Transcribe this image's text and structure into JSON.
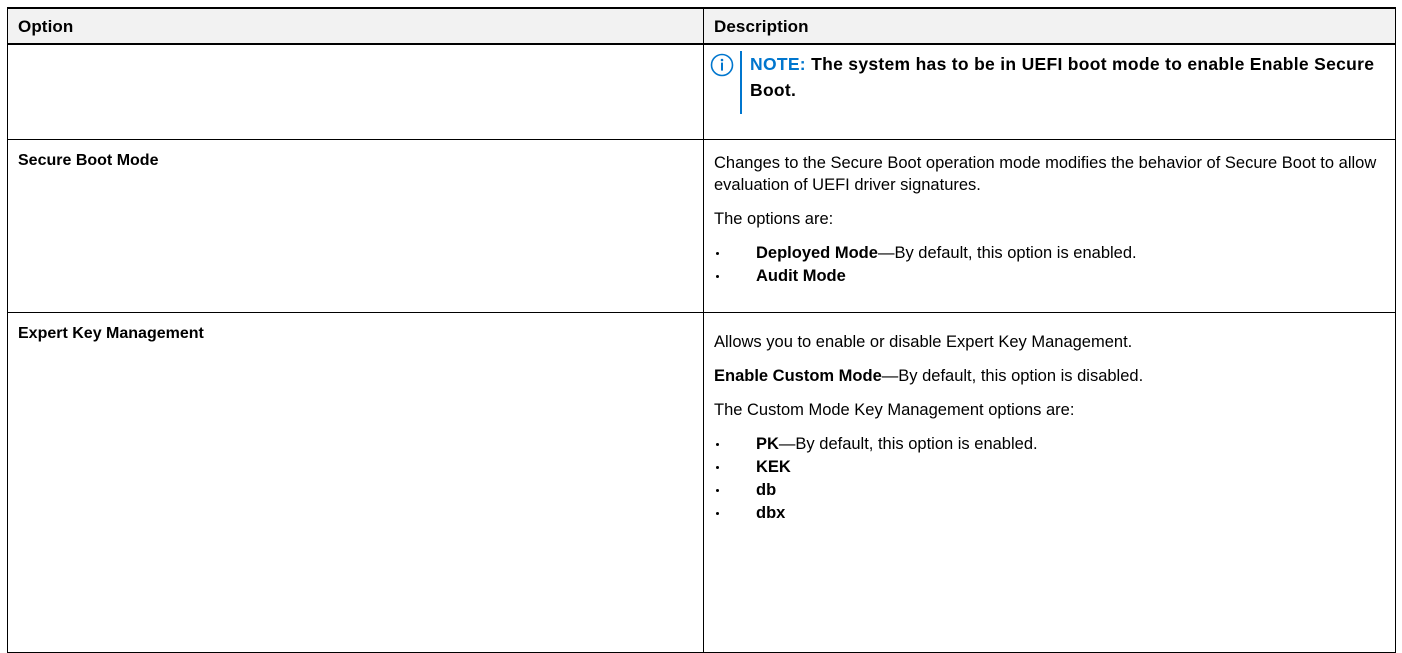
{
  "header": {
    "option": "Option",
    "description": "Description"
  },
  "rows": {
    "note": {
      "label": "NOTE:",
      "text": " The system has to be in UEFI boot mode to enable Enable Secure Boot.",
      "icon": "info-circle-icon",
      "color": "#0076ce"
    },
    "secure_boot_mode": {
      "option": "Secure Boot Mode",
      "para1": "Changes to the Secure Boot operation mode modifies the behavior of Secure Boot to allow evaluation of UEFI driver signatures.",
      "para2": "The options are:",
      "bullets": [
        {
          "bold": "Deployed Mode",
          "rest": "—By default, this option is enabled."
        },
        {
          "bold": "Audit Mode",
          "rest": ""
        }
      ]
    },
    "expert_key_management": {
      "option": "Expert Key Management",
      "para1": "Allows you to enable or disable Expert Key Management.",
      "para2_bold": "Enable Custom Mode",
      "para2_rest": "—By default, this option is disabled.",
      "para3": "The Custom Mode Key Management options are:",
      "bullets": [
        {
          "bold": "PK",
          "rest": "—By default, this option is enabled."
        },
        {
          "bold": "KEK",
          "rest": ""
        },
        {
          "bold": "db",
          "rest": ""
        },
        {
          "bold": "dbx",
          "rest": ""
        }
      ]
    }
  }
}
